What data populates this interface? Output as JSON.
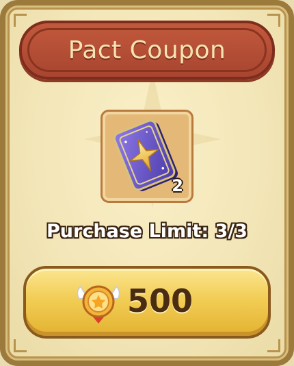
{
  "shop_item": {
    "title": "Pact Coupon",
    "item_icon": "pact-coupon-card-icon",
    "quantity": "2",
    "purchase_limit_label": "Purchase Limit: 3/3"
  },
  "buy_button": {
    "currency_icon": "medal-coin-icon",
    "price": "500"
  },
  "colors": {
    "banner": "#b04d34",
    "button": "#f2cd55",
    "frame": "#9c7a3c"
  }
}
